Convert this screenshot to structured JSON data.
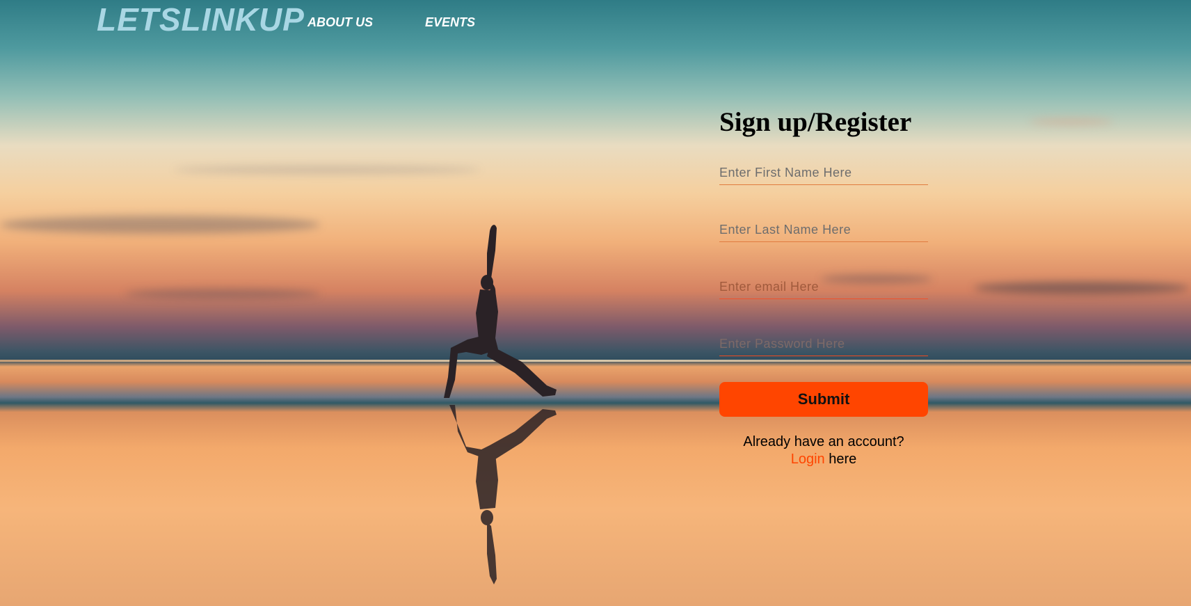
{
  "header": {
    "logo": "LETSLINKUP",
    "nav": [
      {
        "label": "ABOUT US"
      },
      {
        "label": "EVENTS"
      }
    ]
  },
  "form": {
    "title": "Sign up/Register",
    "fields": {
      "first_name": {
        "placeholder": "Enter First Name Here",
        "value": ""
      },
      "last_name": {
        "placeholder": "Enter Last Name Here",
        "value": ""
      },
      "email": {
        "placeholder": "Enter email Here",
        "value": ""
      },
      "password": {
        "placeholder": "Enter Password Here",
        "value": ""
      }
    },
    "submit_label": "Submit",
    "login_prompt": "Already have an account?",
    "login_link": "Login",
    "login_suffix": "here"
  },
  "colors": {
    "accent": "#ff4500",
    "logo": "#a9d7e4",
    "nav_text": "#ffffff"
  },
  "icons": {
    "background": "beach-sunset-yoga-photo"
  }
}
